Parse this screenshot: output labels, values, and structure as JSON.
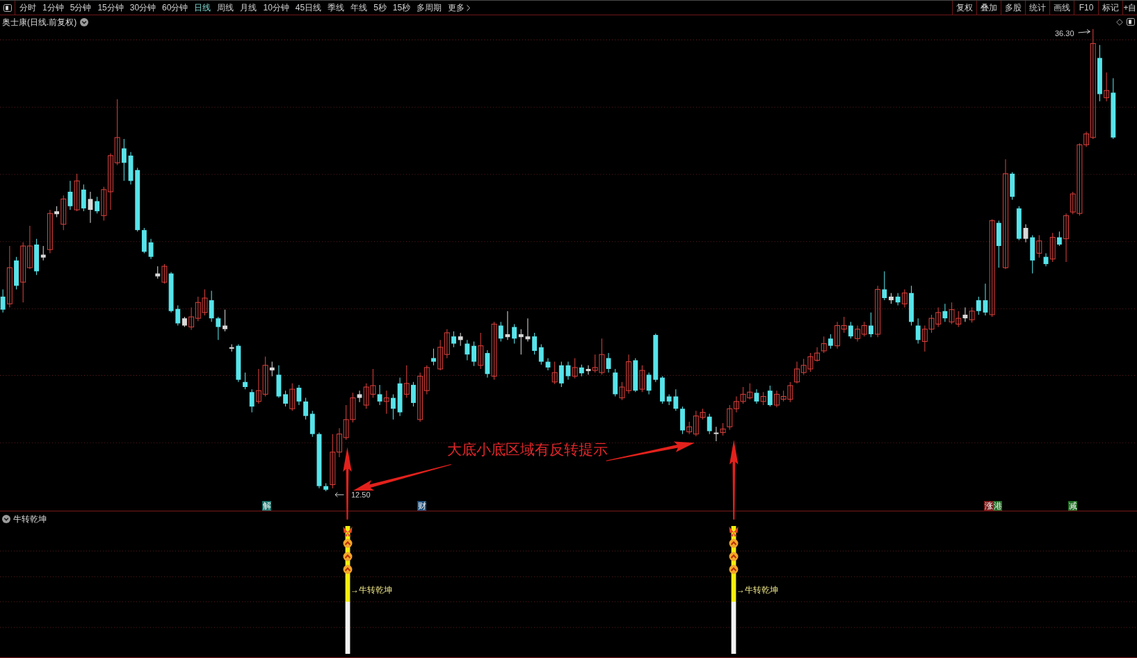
{
  "toolbar": {
    "periods": [
      {
        "label": "分时",
        "selected": false
      },
      {
        "label": "1分钟",
        "selected": false
      },
      {
        "label": "5分钟",
        "selected": false
      },
      {
        "label": "15分钟",
        "selected": false
      },
      {
        "label": "30分钟",
        "selected": false
      },
      {
        "label": "60分钟",
        "selected": false
      },
      {
        "label": "日线",
        "selected": true
      },
      {
        "label": "周线",
        "selected": false
      },
      {
        "label": "月线",
        "selected": false
      },
      {
        "label": "10分钟",
        "selected": false
      },
      {
        "label": "45日线",
        "selected": false
      },
      {
        "label": "季线",
        "selected": false
      },
      {
        "label": "年线",
        "selected": false
      },
      {
        "label": "5秒",
        "selected": false
      },
      {
        "label": "15秒",
        "selected": false
      },
      {
        "label": "多周期",
        "selected": false
      }
    ],
    "more": "更多",
    "tools": [
      "复权",
      "叠加",
      "多股",
      "统计",
      "画线",
      "F10",
      "标记",
      "+自"
    ]
  },
  "chart": {
    "title": "奥士康(日线.前复权)",
    "high_label": "36.30",
    "low_label": "12.50",
    "annotation": "大底小底区域有反转提示",
    "event_tags": [
      {
        "text": "解",
        "color": "#17706a"
      },
      {
        "text": "财",
        "color": "#1c4d78"
      },
      {
        "text": "涨",
        "color": "#7c1c1c"
      },
      {
        "text": "港",
        "color": "#1e6b22"
      },
      {
        "text": "减",
        "color": "#1e6b22"
      }
    ]
  },
  "indicator": {
    "title": "牛转乾坤",
    "signals": [
      {
        "label": "→牛转乾坤"
      },
      {
        "label": "→牛转乾坤"
      }
    ]
  }
}
